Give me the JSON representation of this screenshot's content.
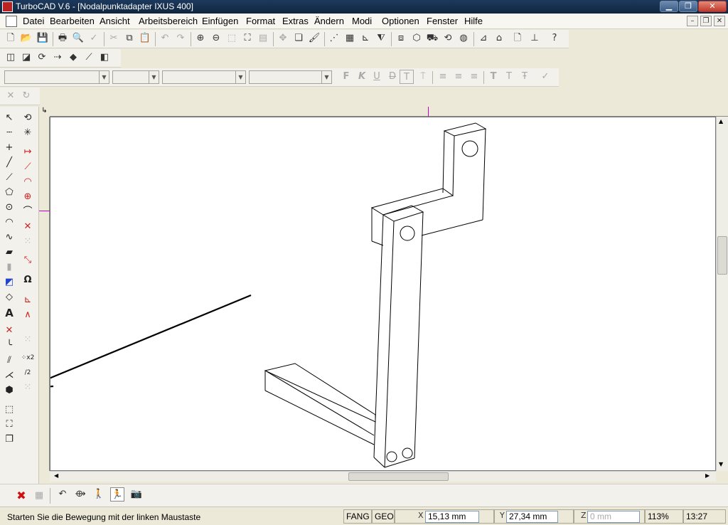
{
  "window": {
    "title": "TurboCAD V.6 - [Nodalpunktadapter IXUS 400]",
    "buttons": {
      "minimize": "▁",
      "restore": "❐",
      "close": "✕"
    }
  },
  "menu": {
    "items": [
      "Datei",
      "Bearbeiten",
      "Ansicht",
      "Arbeitsbereich",
      "Einfügen",
      "Format",
      "Extras",
      "Ändern",
      "Modi",
      "Optionen",
      "Fenster",
      "Hilfe"
    ],
    "mdi_buttons": {
      "minimize": "–",
      "restore": "❐",
      "close": "✕"
    }
  },
  "format_toolbar": {
    "combo1": "",
    "combo2": "",
    "combo3": "",
    "combo4": "",
    "glyphs": {
      "bold": "F",
      "italic": "K",
      "underline": "U",
      "strike": "D",
      "textbox": "T",
      "insert_text": "T",
      "text_style": "T"
    }
  },
  "status": {
    "message": "Starten Sie die Bewegung mit der linken Maustaste",
    "fang": "FANG",
    "geo": "GEO",
    "x_label": "X",
    "x_value": "15,13 mm",
    "y_label": "Y",
    "y_value": "27,34 mm",
    "z_label": "Z",
    "z_placeholder": "0 mm",
    "zoom": "113%",
    "time": "13:27"
  },
  "colors": {
    "titlebar": "#1c3a5e",
    "close": "#c0392b",
    "crosshair": "#cc00cc",
    "delete_icon": "#d01010"
  }
}
